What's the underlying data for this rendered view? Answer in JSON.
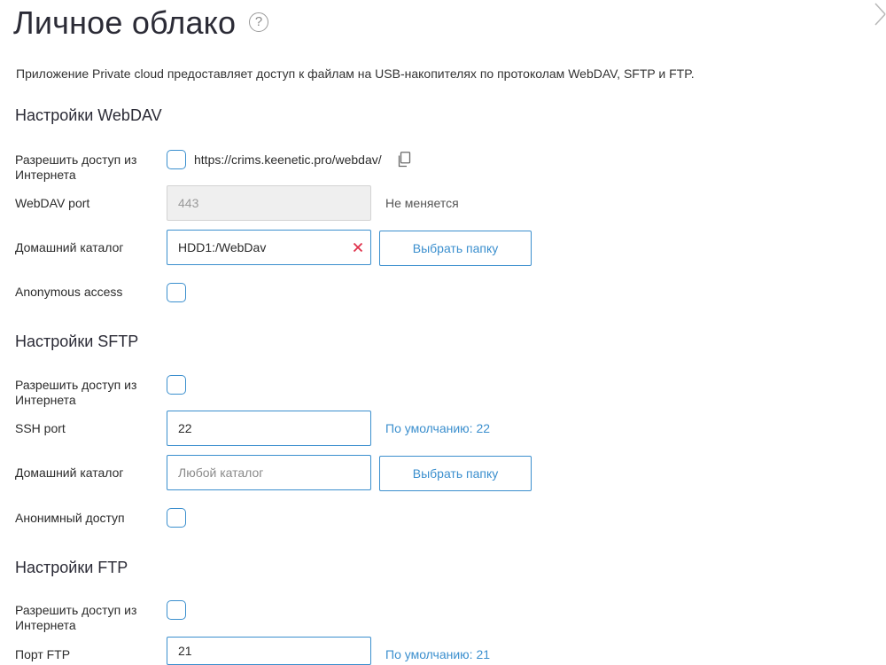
{
  "header": {
    "title": "Личное облако",
    "help_icon": "question-circle-icon",
    "close_icon": "close-icon"
  },
  "intro": "Приложение Private cloud предоставляет доступ к файлам на USB-накопителях по протоколам WebDAV, SFTP и FTP.",
  "webdav": {
    "title": "Настройки WebDAV",
    "internet_access": {
      "label_line1": "Разрешить доступ из",
      "label_line2": "Интернета",
      "checked": false
    },
    "url": "https://crims.keenetic.pro/webdav/",
    "port": {
      "label": "WebDAV port",
      "value": "443",
      "hint": "Не меняется"
    },
    "home_dir": {
      "label": "Домашний каталог",
      "value": "HDD1:/WebDav",
      "button": "Выбрать папку"
    },
    "anonymous": {
      "label": "Anonymous access",
      "checked": false
    }
  },
  "sftp": {
    "title": "Настройки SFTP",
    "internet_access": {
      "label_line1": "Разрешить доступ из",
      "label_line2": "Интернета",
      "checked": false
    },
    "port": {
      "label": "SSH port",
      "value": "22",
      "hint": "По умолчанию: 22"
    },
    "home_dir": {
      "label": "Домашний каталог",
      "value": "",
      "placeholder": "Любой каталог",
      "button": "Выбрать папку"
    },
    "anonymous": {
      "label": "Анонимный доступ",
      "checked": false
    }
  },
  "ftp": {
    "title": "Настройки FTP",
    "internet_access": {
      "label_line1": "Разрешить доступ из",
      "label_line2": "Интернета",
      "checked": false
    },
    "port": {
      "label": "Порт FTP",
      "value": "21",
      "hint": "По умолчанию: 21"
    }
  },
  "colors": {
    "accent": "#3b8fce",
    "clear": "#e0314b",
    "title": "#2b2b36"
  }
}
